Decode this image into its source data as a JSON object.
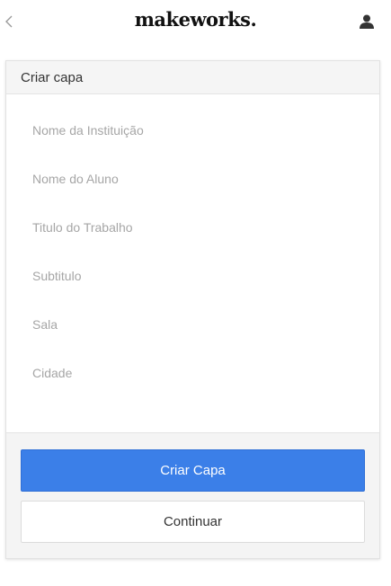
{
  "header": {
    "logo_text": "makeworks.",
    "back_icon": "chevron-left-icon",
    "user_icon": "user-icon"
  },
  "card": {
    "title": "Criar capa"
  },
  "form": {
    "fields": [
      {
        "placeholder": "Nome da Instituição",
        "value": ""
      },
      {
        "placeholder": "Nome do Aluno",
        "value": ""
      },
      {
        "placeholder": "Titulo do Trabalho",
        "value": ""
      },
      {
        "placeholder": "Subtitulo",
        "value": ""
      },
      {
        "placeholder": "Sala",
        "value": ""
      },
      {
        "placeholder": "Cidade",
        "value": ""
      }
    ]
  },
  "actions": {
    "primary_label": "Criar Capa",
    "secondary_label": "Continuar"
  },
  "colors": {
    "primary": "#3b7fe8",
    "footer_bg": "#f4f4f4",
    "header_bg": "#f5f5f5"
  }
}
